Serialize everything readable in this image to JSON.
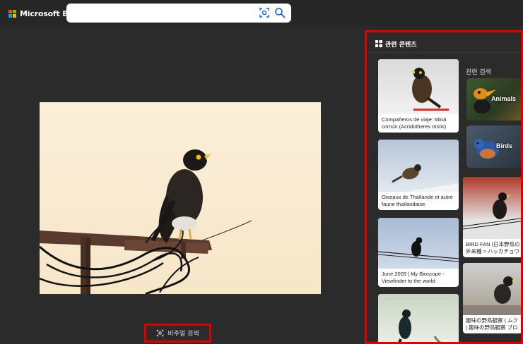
{
  "header": {
    "brand": "Microsoft Bing",
    "search_value": "",
    "search_placeholder": ""
  },
  "visual_search": {
    "label": "비주얼 검색"
  },
  "panel": {
    "tab_label": "관련 콘텐츠",
    "results": [
      {
        "caption": "Compañeros de viaje: Miná común (Acridotheres tristis)"
      },
      {
        "caption": "Oiseaux de Thaïlande et autre faune thaïlandaise"
      },
      {
        "caption": "June 2009 | My Bioscope - Viewfinder to the world"
      }
    ],
    "related_title": "관련 검색",
    "related": [
      {
        "label": "Animals"
      },
      {
        "label": "Birds"
      }
    ],
    "results_right": [
      {
        "line1": "BIRD FAN (日本野鳥の",
        "line2": "外来種 > ハッカチョウ"
      },
      {
        "line1": "趣味の野鳥観察 ( ムク",
        "line2": "| 趣味の野鳥観察 ブロ"
      }
    ]
  },
  "colors": {
    "highlight": "#e00000",
    "background": "#2b2b2b"
  }
}
